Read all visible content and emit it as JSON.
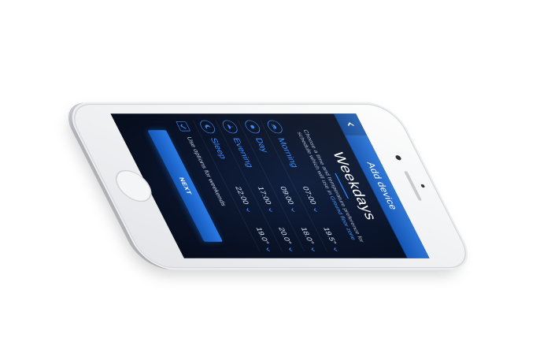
{
  "header": {
    "title": "Add device",
    "back_icon": "chevron-left-icon"
  },
  "page": {
    "title": "Weekdays",
    "instructions_prefix": "Choose a time and temperature preference for schedule which will use in",
    "zone_name": "Ground floor zone"
  },
  "schedule": [
    {
      "label": "Morning",
      "icon": "sunrise-icon",
      "time": "07:00",
      "temp": "19.5°"
    },
    {
      "label": "Day",
      "icon": "sun-icon",
      "time": "09:00",
      "temp": "18.0°"
    },
    {
      "label": "Evening",
      "icon": "sunset-icon",
      "time": "17:00",
      "temp": "20.0°"
    },
    {
      "label": "Sleep",
      "icon": "moon-icon",
      "time": "22:00",
      "temp": "19.0°"
    }
  ],
  "options": {
    "checked": true,
    "label": "Use options for weekends"
  },
  "next_label": "NEXT",
  "colors": {
    "accent": "#2f86ff",
    "header": "#1f66c8",
    "screen_bg": "#0a1429",
    "phone_body": "#f1f2f4"
  }
}
